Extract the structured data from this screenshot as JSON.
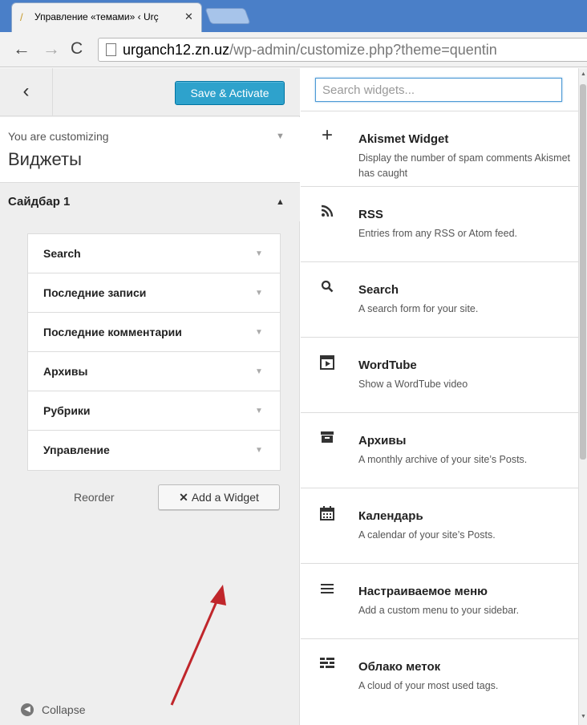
{
  "browser": {
    "tab_title": "Управление «темами» ‹ Urç",
    "tab_close": "✕",
    "url_host": "urganch12.zn.uz",
    "url_path": "/wp-admin/customize.php?theme=quentin",
    "back": "←",
    "forward": "→",
    "reload": "C"
  },
  "header": {
    "close_icon": "‹",
    "save_activate_label": "Save & Activate"
  },
  "info": {
    "customizing_label": "You are customizing",
    "title": "Виджеты"
  },
  "sidebar": {
    "title": "Сайдбар 1",
    "widgets": [
      {
        "label": "Search"
      },
      {
        "label": "Последние записи"
      },
      {
        "label": "Последние комментарии"
      },
      {
        "label": "Архивы"
      },
      {
        "label": "Рубрики"
      },
      {
        "label": "Управление"
      }
    ],
    "reorder_label": "Reorder",
    "add_widget_label": "Add a Widget"
  },
  "collapse_label": "Collapse",
  "available": {
    "search_placeholder": "Search widgets...",
    "widgets": [
      {
        "icon": "plus-icon",
        "glyph": "+",
        "title": "Akismet Widget",
        "desc": "Display the number of spam comments Akismet has caught"
      },
      {
        "icon": "rss-icon",
        "glyph": "ෆ",
        "title": "RSS",
        "desc": "Entries from any RSS or Atom feed."
      },
      {
        "icon": "search-icon",
        "glyph": "⚲",
        "title": "Search",
        "desc": "A search form for your site."
      },
      {
        "icon": "video-icon",
        "glyph": "▶",
        "title": "WordTube",
        "desc": "Show a WordTube video"
      },
      {
        "icon": "archive-icon",
        "glyph": "▬",
        "title": "Архивы",
        "desc": "A monthly archive of your site’s Posts."
      },
      {
        "icon": "calendar-icon",
        "glyph": "▦",
        "title": "Календарь",
        "desc": "A calendar of your site’s Posts."
      },
      {
        "icon": "menu-icon",
        "glyph": "≡",
        "title": "Настраиваемое меню",
        "desc": "Add a custom menu to your sidebar."
      },
      {
        "icon": "tag-cloud-icon",
        "glyph": "☷",
        "title": "Облако меток",
        "desc": "A cloud of your most used tags."
      }
    ]
  },
  "colors": {
    "accent": "#2ea2cc",
    "arrow": "#c0262b"
  }
}
